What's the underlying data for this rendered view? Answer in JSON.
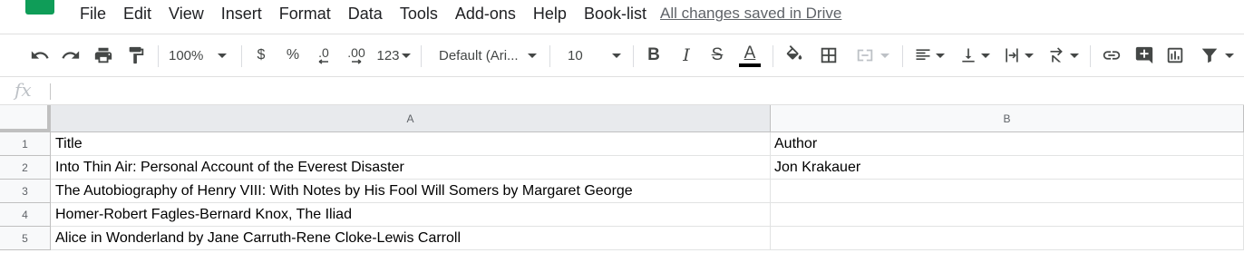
{
  "menu": {
    "items": [
      "File",
      "Edit",
      "View",
      "Insert",
      "Format",
      "Data",
      "Tools",
      "Add-ons",
      "Help",
      "Book-list"
    ],
    "save_status": "All changes saved in Drive"
  },
  "toolbar": {
    "zoom": "100%",
    "currency": "$",
    "percent": "%",
    "decrease_decimal": ".0",
    "increase_decimal": ".00",
    "more_formats": "123",
    "font": "Default (Ari...",
    "font_size": "10",
    "bold": "B",
    "italic": "I",
    "strikethrough": "S",
    "text_color": "A",
    "colors": {
      "text_color_bar": "#000000",
      "disabled": "#bdc1c6"
    }
  },
  "formula_bar": {
    "fx_label": "fx",
    "value": ""
  },
  "grid": {
    "columns": [
      "A",
      "B"
    ],
    "rows": [
      {
        "num": "1",
        "a": "Title",
        "b": "Author"
      },
      {
        "num": "2",
        "a": "Into Thin Air: Personal Account of the Everest Disaster",
        "b": "Jon Krakauer"
      },
      {
        "num": "3",
        "a": "The Autobiography of Henry VIII: With Notes by His Fool Will Somers by Margaret George",
        "b": ""
      },
      {
        "num": "4",
        "a": "Homer-Robert Fagles-Bernard Knox, The Iliad",
        "b": ""
      },
      {
        "num": "5",
        "a": "Alice in Wonderland by Jane Carruth-Rene Cloke-Lewis Carroll",
        "b": ""
      }
    ]
  }
}
